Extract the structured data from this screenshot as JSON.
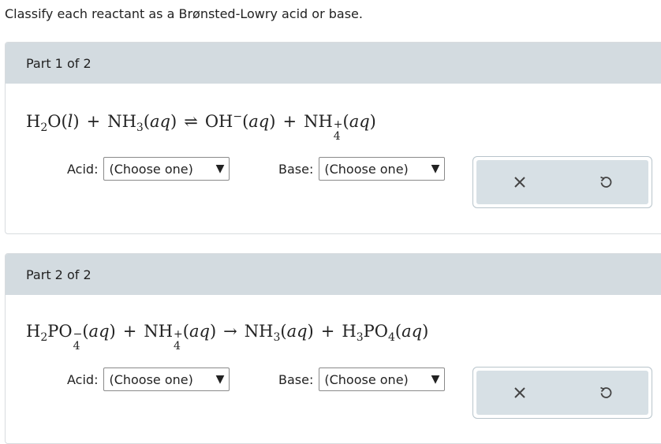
{
  "instruction": "Classify each reactant as a Brønsted-Lowry acid or base.",
  "parts": [
    {
      "title": "Part 1 of 2",
      "acid_label": "Acid:",
      "base_label": "Base:",
      "acid_value": "(Choose one)",
      "base_value": "(Choose one)",
      "dropdown_arrow": "▼"
    },
    {
      "title": "Part 2 of 2",
      "acid_label": "Acid:",
      "base_label": "Base:",
      "acid_value": "(Choose one)",
      "base_value": "(Choose one)",
      "dropdown_arrow": "▼"
    }
  ],
  "icons": {
    "clear": "close-icon",
    "undo": "undo-icon"
  },
  "colors": {
    "header_bg": "#d3dbe0",
    "action_bg": "#d7e0e5"
  }
}
